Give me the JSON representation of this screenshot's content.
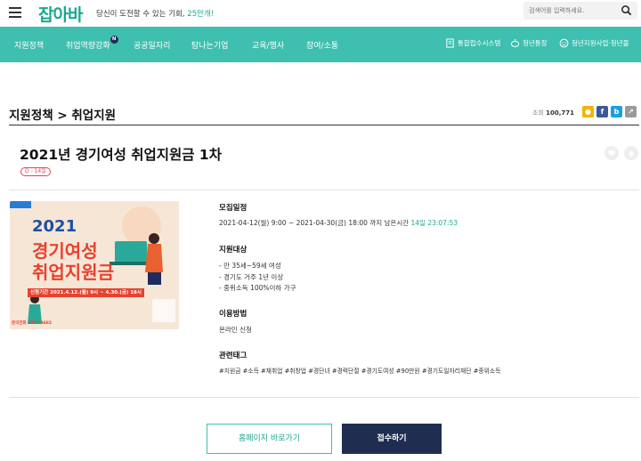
{
  "header": {
    "logo": "잡아바",
    "tagline_prefix": "당신이 도전할 수 있는 기회, ",
    "tagline_highlight": "25만개!",
    "search_placeholder": "검색어를 입력하세요.",
    "brand_color": "#1aa88f"
  },
  "nav": {
    "items": [
      {
        "label": "지원정책"
      },
      {
        "label": "취업역량강화",
        "badge": "N"
      },
      {
        "label": "공공일자리"
      },
      {
        "label": "탐나는기업"
      },
      {
        "label": "교육/행사"
      },
      {
        "label": "참여/소통"
      }
    ],
    "right_links": [
      {
        "label": "통합접수시스템",
        "icon": "document-icon"
      },
      {
        "label": "청년통장",
        "icon": "piggy-bank-icon"
      },
      {
        "label": "청년지원사업·청년몰",
        "icon": "smile-face-icon"
      }
    ],
    "bg_color": "#3ebfaf"
  },
  "page": {
    "breadcrumb_title": "지원정책 > 취업지원",
    "views_label": "조회",
    "views_count": "100,771",
    "share_buttons": [
      {
        "name": "kakaostory",
        "glyph": "●",
        "color": "#f5b400"
      },
      {
        "name": "facebook",
        "glyph": "f",
        "color": "#3b5998"
      },
      {
        "name": "blog",
        "glyph": "b",
        "color": "#1aa0e0"
      },
      {
        "name": "share",
        "glyph": "↗",
        "color": "#9a9a9a"
      }
    ]
  },
  "post": {
    "title": "2021년 경기여성 취업지원금 1차",
    "dday": "D - 14일",
    "poster": {
      "line1": "2021",
      "line2": "경기여성",
      "line3": "취업지원금",
      "period": "신청기간  2021.4.12.(월) 9시 ~ 4.30.(금) 18시",
      "contact": "문의전화 1522-3682"
    },
    "sections": {
      "schedule_label": "모집일정",
      "schedule_text": "2021-04-12(월) 9:00 ~ 2021-04-30(금) 18:00 까지 남은시간 ",
      "schedule_remaining": "14일 23:07:53",
      "target_label": "지원대상",
      "target_lines": [
        "- 만 35세~59세 여성",
        "- 경기도 거주 1년 이상",
        "- 중위소득 100%이하 가구"
      ],
      "method_label": "이용방법",
      "method_text": "온라인 신청",
      "tags_label": "관련태그",
      "tags_text": "#지원금 #소득 #재취업 #취창업 #경단녀 #경력단절 #경기도여성 #90만원 #경기도일자리재단 #중위소득"
    }
  },
  "actions": {
    "homepage_label": "홈페이지 바로가기",
    "apply_label": "접수하기"
  }
}
